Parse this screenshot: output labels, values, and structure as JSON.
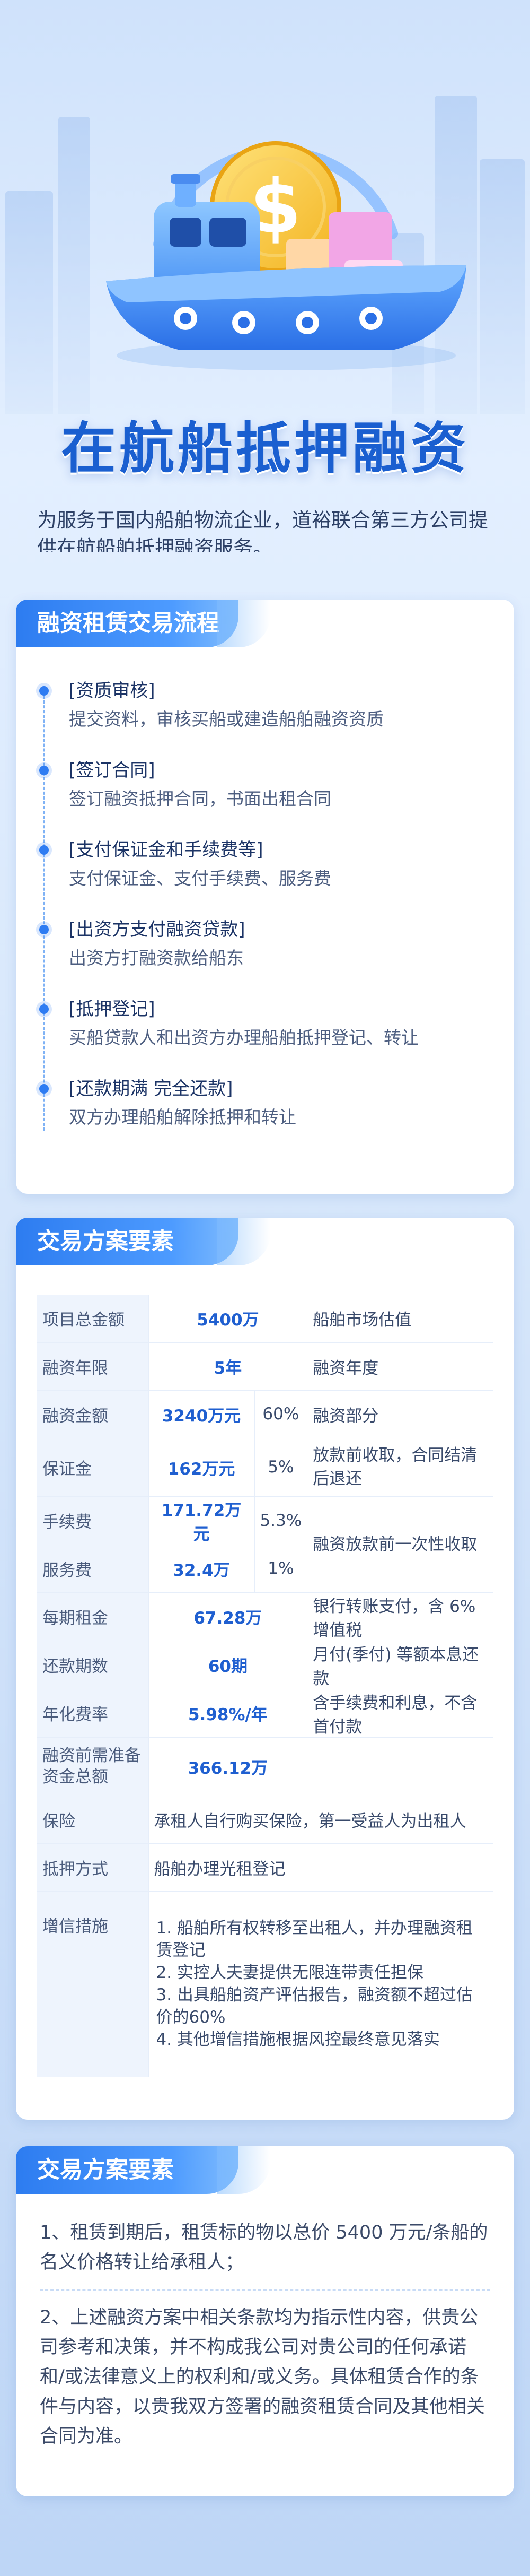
{
  "hero": {
    "title": "在航船抵押融资",
    "subtitle": "为服务于国内船舶物流企业，道裕联合第三方公司提供在航船舶抵押融资服务。"
  },
  "process": {
    "heading": "融资租赁交易流程",
    "steps": [
      {
        "title": "[资质审核]",
        "desc": "提交资料，审核买船或建造船舶融资资质"
      },
      {
        "title": "[签订合同]",
        "desc": "签订融资抵押合同，书面出租合同"
      },
      {
        "title": "[支付保证金和手续费等]",
        "desc": "支付保证金、支付手续费、服务费"
      },
      {
        "title": "[出资方支付融资贷款]",
        "desc": "出资方打融资款给船东"
      },
      {
        "title": "[抵押登记]",
        "desc": "买船贷款人和出资方办理船舶抵押登记、转让"
      },
      {
        "title": "[还款期满 完全还款]",
        "desc": "双方办理船舶解除抵押和转让"
      }
    ]
  },
  "plan": {
    "heading": "交易方案要素",
    "rows": {
      "r1": {
        "k": "项目总金额",
        "v": "5400万",
        "d": "船舶市场估值"
      },
      "r2": {
        "k": "融资年限",
        "v": "5年",
        "d": "融资年度"
      },
      "r3": {
        "k": "融资金额",
        "v": "3240万元",
        "p": "60%",
        "d": "融资部分"
      },
      "r4": {
        "k": "保证金",
        "v": "162万元",
        "p": "5%",
        "d": "放款前收取，合同结清后退还"
      },
      "r5": {
        "k": "手续费",
        "v": "171.72万元",
        "p": "5.3%",
        "d": "融资放款前一次性收取"
      },
      "r6": {
        "k": "服务费",
        "v": "32.4万",
        "p": "1%"
      },
      "r7": {
        "k": "每期租金",
        "v": "67.28万",
        "d": "银行转账支付，含 6%增值税"
      },
      "r8": {
        "k": "还款期数",
        "v": "60期",
        "d": "月付(季付) 等额本息还款"
      },
      "r9": {
        "k": "年化费率",
        "v": "5.98%/年",
        "d": "含手续费和利息，不含首付款"
      },
      "r10": {
        "k": "融资前需准备资金总额",
        "v": "366.12万"
      },
      "r11": {
        "k": "保险",
        "d": "承租人自行购买保险，第一受益人为出租人"
      },
      "r12": {
        "k": "抵押方式",
        "d": "船舶办理光租登记"
      },
      "r13": {
        "k": "增信措施",
        "lines": [
          "1. 船舶所有权转移至出租人，并办理融资租赁登记",
          "2. 实控人夫妻提供无限连带责任担保",
          "3. 出具船舶资产评估报告，融资额不超过估价的60%",
          "4. 其他增信措施根据风控最终意见落实"
        ]
      }
    }
  },
  "notes": {
    "heading": "交易方案要素",
    "n1": "1、租赁到期后，租赁标的物以总价 5400 万元/条船的名义价格转让给承租人；",
    "n2": "2、上述融资方案中相关条款均为指示性内容，供贵公司参考和决策，并不构成我公司对贵公司的任何承诺和/或法律意义上的权利和/或义务。具体租赁合作的条件与内容，以贵我双方签署的融资租赁合同及其他相关合同为准。"
  },
  "colors": {
    "accent": "#2d7cf0",
    "title": "#1a5fd0",
    "dot": "#2e7cf2"
  },
  "icons": {
    "hero": "cargo-ship-with-dollar-coin-illustration"
  }
}
